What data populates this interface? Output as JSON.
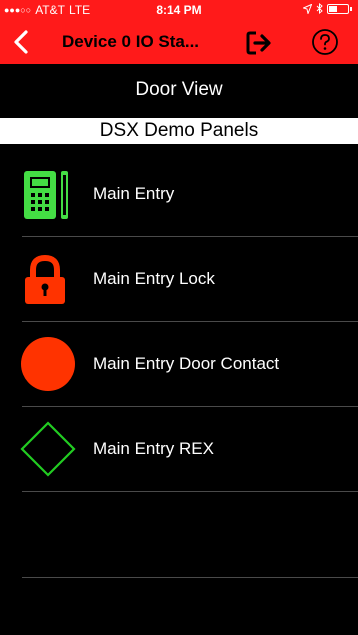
{
  "status_bar": {
    "carrier": "AT&T",
    "network": "LTE",
    "time": "8:14 PM"
  },
  "nav": {
    "title": "Device 0 IO Sta...",
    "back_icon": "chevron-left-icon",
    "logout_icon": "logout-icon",
    "help_icon": "help-circle-icon"
  },
  "view_title": "Door View",
  "panel_name": "DSX Demo Panels",
  "items": [
    {
      "label": "Main Entry",
      "icon": "reader-icon"
    },
    {
      "label": "Main Entry Lock",
      "icon": "lock-icon"
    },
    {
      "label": "Main Entry Door Contact",
      "icon": "circle-icon"
    },
    {
      "label": "Main Entry REX",
      "icon": "diamond-icon"
    }
  ],
  "colors": {
    "header_red": "#ff1a1a",
    "status_red": "#ff3300",
    "status_green": "#22cc22",
    "reader_green": "#44dd44"
  }
}
